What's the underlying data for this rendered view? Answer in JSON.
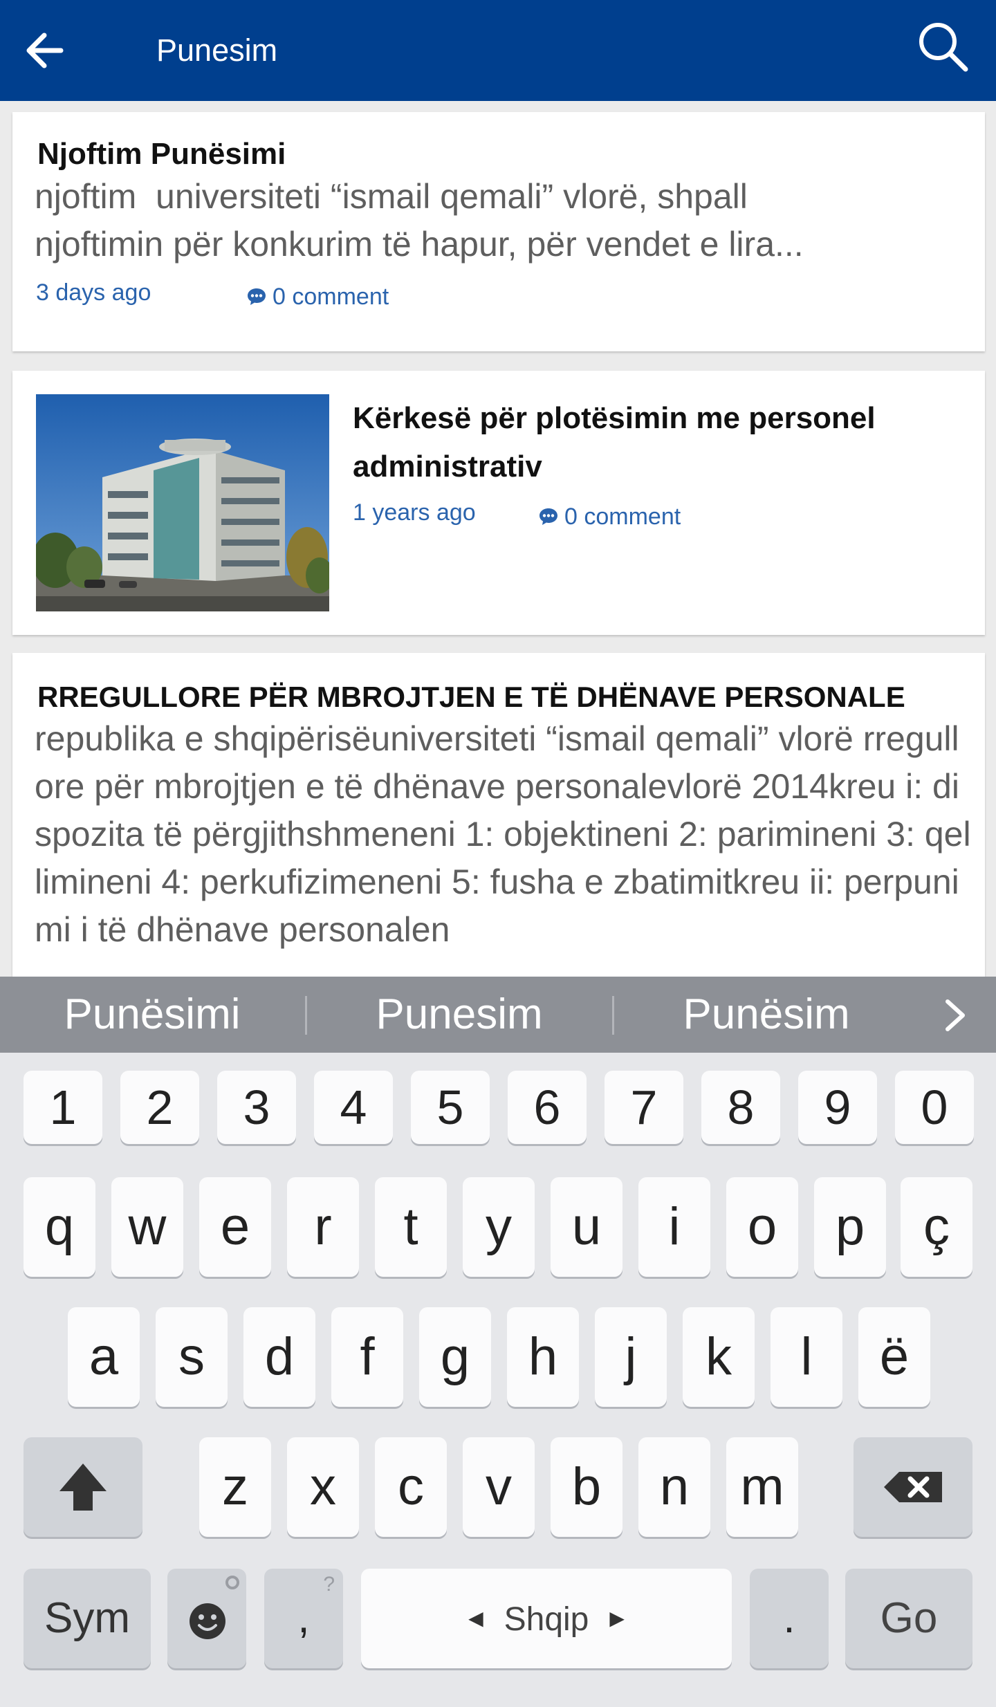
{
  "app_bar": {
    "search_value": "Punesim",
    "back_icon": "arrow-back-icon",
    "search_icon": "search-icon",
    "color": "#003f8e"
  },
  "results": [
    {
      "title": "Njoftim Punësimi",
      "snippet": "njoftim  universiteti “ismail qemali” vlorë, shpall njoftimin për konkurim të hapur, për vendet e lira...",
      "date": "3 days ago",
      "comments": "0 comment"
    },
    {
      "title": "Kërkesë për plotësimin me personel administrativ",
      "date": "1 years ago",
      "comments": "0 comment",
      "thumbnail": "university-building-photo"
    },
    {
      "title": "RREGULLORE PËR MBROJTJEN E TË DHËNAVE PERSONALE",
      "snippet": "republika e shqipërisëuniversiteti “ismail qemali” vlorë rregullore për mbrojtjen e të dhënave personalevlorë 2014kreu i: dispozita të përgjithshmeneni 1: objektineni 2: parimineni 3: qellimineni 4: perkufizimeneni 5: fusha e zbatimitkreu ii: perpunimi i të dhënave personalen"
    }
  ],
  "suggestions": [
    "Punësimi",
    "Punesim",
    "Punësim"
  ],
  "keyboard": {
    "numbers": [
      "1",
      "2",
      "3",
      "4",
      "5",
      "6",
      "7",
      "8",
      "9",
      "0"
    ],
    "row1": [
      "q",
      "w",
      "e",
      "r",
      "t",
      "y",
      "u",
      "i",
      "o",
      "p",
      "ç"
    ],
    "row2": [
      "a",
      "s",
      "d",
      "f",
      "g",
      "h",
      "j",
      "k",
      "l",
      "ë"
    ],
    "row3": [
      "z",
      "x",
      "c",
      "v",
      "b",
      "n",
      "m"
    ],
    "sym": "Sym",
    "comma": ",",
    "comma_hint": "?",
    "space_label": "Shqip",
    "period": ".",
    "go": "Go"
  },
  "accent_color": "#2a63ad"
}
